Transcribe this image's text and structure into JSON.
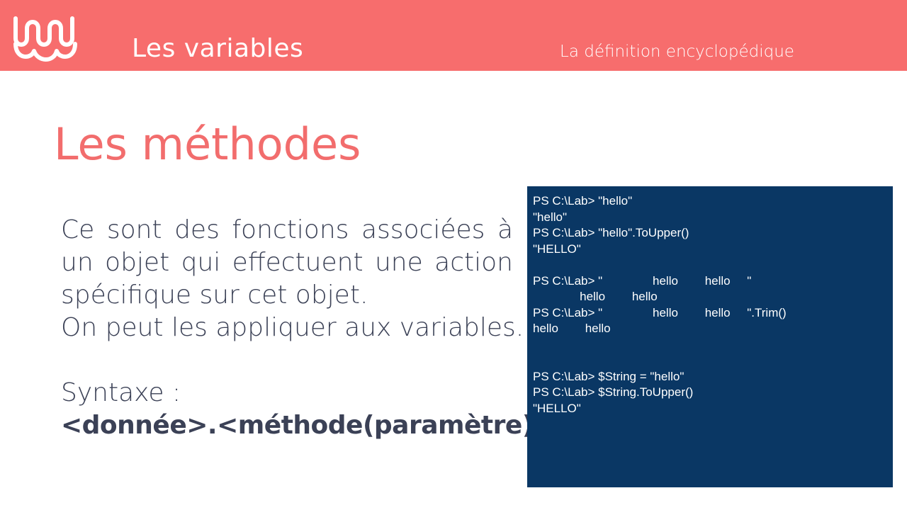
{
  "header": {
    "title": "Les variables",
    "subtitle": "La définition encyclopédique",
    "background_color": "#f76d6d"
  },
  "logo": {
    "icon": "wave-logo-icon"
  },
  "main": {
    "title": "Les méthodes",
    "title_color": "#f26d6d",
    "paragraph": "Ce sont des fonctions associées à un objet qui effectuent une action spécifique sur cet objet.",
    "paragraph_2": "On peut les appliquer aux variables.",
    "syntax_label": "Syntaxe :",
    "syntax_value": "<donnée>.<méthode(paramètre)>"
  },
  "console": {
    "background_color": "#0a3764",
    "lines": [
      "PS C:\\Lab> \"hello\"",
      "\"hello\"",
      "PS C:\\Lab> \"hello\".ToUpper()",
      "\"HELLO\"",
      "",
      "PS C:\\Lab> \"               hello        hello     \"",
      "              hello        hello",
      "PS C:\\Lab> \"               hello        hello     \".Trim()",
      "hello        hello",
      "",
      "",
      "PS C:\\Lab> $String = \"hello\"",
      "PS C:\\Lab> $String.ToUpper()",
      "\"HELLO\""
    ]
  }
}
